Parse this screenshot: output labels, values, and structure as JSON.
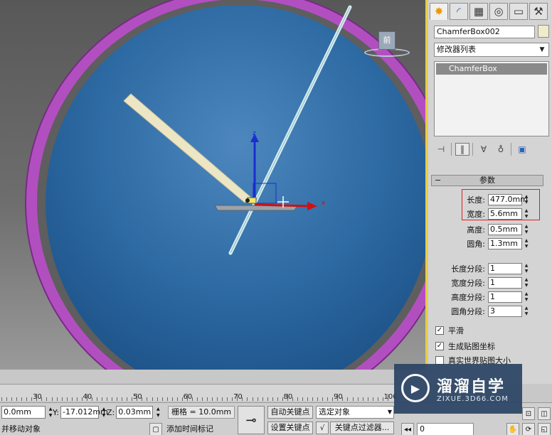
{
  "viewport": {
    "viewcube_label": "前",
    "axis_labels": {
      "z": "z",
      "x": "x"
    }
  },
  "command_panel": {
    "tab_icons": [
      "create-icon",
      "modify-icon",
      "hierarchy-icon",
      "motion-icon",
      "display-icon",
      "utilities-icon"
    ],
    "object_name": "ChamferBox002",
    "object_color": "#f1ebc8",
    "modifier_list": "修改器列表",
    "stack_items": [
      "ChamferBox"
    ],
    "rollout_title": "参数",
    "params": [
      {
        "label": "长度:",
        "value": "477.0mm"
      },
      {
        "label": "宽度:",
        "value": "5.6mm"
      },
      {
        "label": "高度:",
        "value": "0.5mm"
      },
      {
        "label": "圆角:",
        "value": "1.3mm"
      }
    ],
    "segments": [
      {
        "label": "长度分段:",
        "value": "1"
      },
      {
        "label": "宽度分段:",
        "value": "1"
      },
      {
        "label": "高度分段:",
        "value": "1"
      },
      {
        "label": "圆角分段:",
        "value": "3"
      }
    ],
    "checkboxes": [
      {
        "label": "平滑",
        "checked": true
      },
      {
        "label": "生成贴图坐标",
        "checked": true
      },
      {
        "label": "真实世界贴图大小",
        "checked": false
      }
    ]
  },
  "timeline": {
    "ticks": [
      "30",
      "40",
      "50",
      "60",
      "70",
      "80",
      "90",
      "100"
    ]
  },
  "status": {
    "x_value": "0.0mm",
    "y_label": "Y:",
    "y_value": "-17.012mm",
    "z_label": "Z:",
    "z_value": "0.03mm",
    "grid": "栅格 = 10.0mm",
    "auto_key": "自动关键点",
    "selected_object": "选定对象",
    "set_key": "设置关键点",
    "key_filters": "关键点过滤器...",
    "add_time_tag": "添加时间标记",
    "prompt": "并移动对象",
    "frame_value": "0"
  },
  "watermark": {
    "title": "溜溜自学",
    "url": "ZIXUE.3D66.COM"
  },
  "colors": {
    "viewport_bg": "#2f6aa4",
    "ring": "#b94ec4",
    "highlight": "#e02020"
  }
}
